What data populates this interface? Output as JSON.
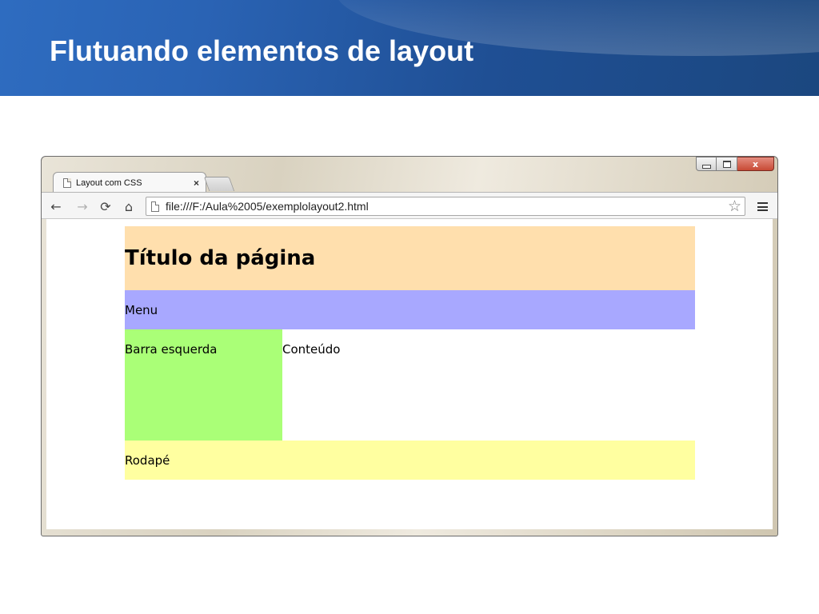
{
  "slide": {
    "title": "Flutuando elementos de layout"
  },
  "browser": {
    "tab": {
      "title": "Layout com CSS",
      "close": "×"
    },
    "toolbar": {
      "back": "←",
      "forward": "→",
      "reload": "⟳",
      "home": "⌂",
      "url": "file:///F:/Aula%2005/exemplolayout2.html",
      "star": "☆"
    },
    "window_controls": {
      "close": "x"
    }
  },
  "site": {
    "header_title": "Título da página",
    "menu": "Menu",
    "sidebar": "Barra esquerda",
    "content": "Conteúdo",
    "footer": "Rodapé"
  },
  "colors": {
    "header_bg": "#ffdfad",
    "menu_bg": "#a8a8ff",
    "sidebar_bg": "#aaff77",
    "footer_bg": "#ffffa0",
    "slide_band": "#2a63b4"
  }
}
